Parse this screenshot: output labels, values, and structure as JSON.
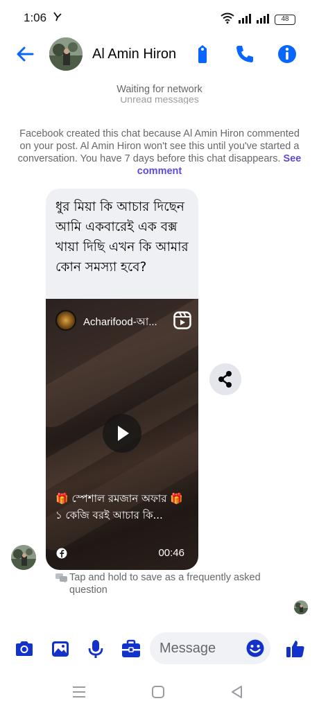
{
  "status_bar": {
    "time": "1:06",
    "battery": "48"
  },
  "header": {
    "contact_name": "Al Amin Hiron"
  },
  "network_status": "Waiting for network",
  "unread_hint": "Unread messages",
  "system_note": {
    "text": "Facebook created this chat because Al Amin Hiron commented on your post. Al Amin Hiron won't see this until you've started a conversation. You have 7 days before this chat disappears.",
    "link": "See comment"
  },
  "message": {
    "text": "ধুর মিয়া কি আচার দিছেন আমি একবারেই এক বক্স খায়া দিছি এখন কি আমার কোন সমস্যা হবে?",
    "reel": {
      "page_name": "Acharifood-আ...",
      "caption_line1": "🎁 স্পেশাল রমজান অফার 🎁",
      "caption_line2": "১ কেজি বরই আচার কি...",
      "duration": "00:46"
    }
  },
  "faq_hint": "Tap and hold to save as a frequently asked question",
  "composer": {
    "placeholder": "Message"
  },
  "colors": {
    "accent": "#0866ff",
    "composer_icon": "#1332c9",
    "muted": "#65676b",
    "link": "#5b4bdb"
  },
  "icons": {
    "status": [
      "vpn-icon",
      "wifi-icon",
      "signal-icon",
      "battery-icon"
    ],
    "header": [
      "back-arrow-icon",
      "tag-icon",
      "phone-icon",
      "info-icon"
    ],
    "composer": [
      "camera-icon",
      "gallery-icon",
      "microphone-icon",
      "briefcase-icon",
      "emoji-icon",
      "thumbs-up-icon"
    ],
    "nav": [
      "menu-icon",
      "home-icon",
      "back-icon"
    ]
  }
}
